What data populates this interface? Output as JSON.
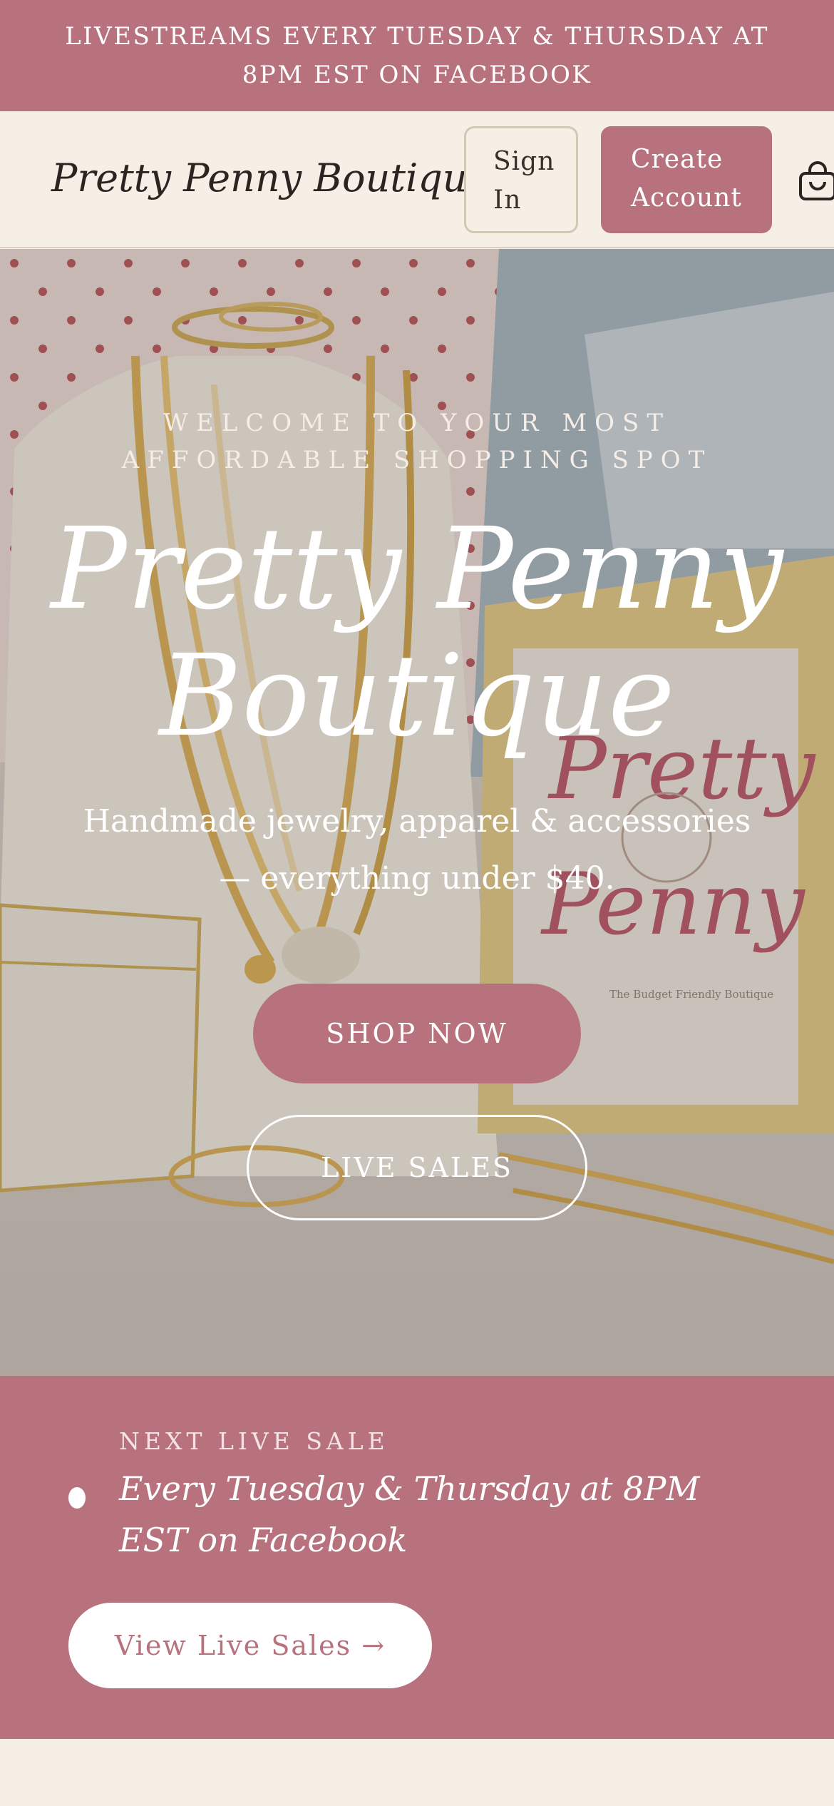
{
  "announcement": {
    "text": "LIVESTREAMS EVERY TUESDAY & THURSDAY AT 8PM EST ON FACEBOOK"
  },
  "header": {
    "brand": "Pretty Penny Boutique",
    "sign_in_line1": "Sign",
    "sign_in_line2": "In",
    "create_line1": "Create",
    "create_line2": "Account",
    "cart_icon": "shopping-bag-icon"
  },
  "hero": {
    "kicker": "WELCOME TO YOUR MOST AFFORDABLE SHOPPING SPOT",
    "title_line1": "Pretty Penny",
    "title_line2": "Boutique",
    "subtitle": "Handmade jewelry, apparel & accessories — everything under $40.",
    "shop_button": "SHOP NOW",
    "live_button": "LIVE SALES",
    "photo_sign_text1": "Pretty",
    "photo_sign_text2": "Penny",
    "photo_sign_caption": "The Budget Friendly Boutique"
  },
  "live": {
    "kicker": "NEXT LIVE SALE",
    "schedule": "Every Tuesday & Thursday at 8PM EST on Facebook",
    "button": "View Live Sales →"
  },
  "colors": {
    "accent": "#b8727d",
    "cream": "#f6efe6",
    "text_dark": "#2b2420"
  }
}
